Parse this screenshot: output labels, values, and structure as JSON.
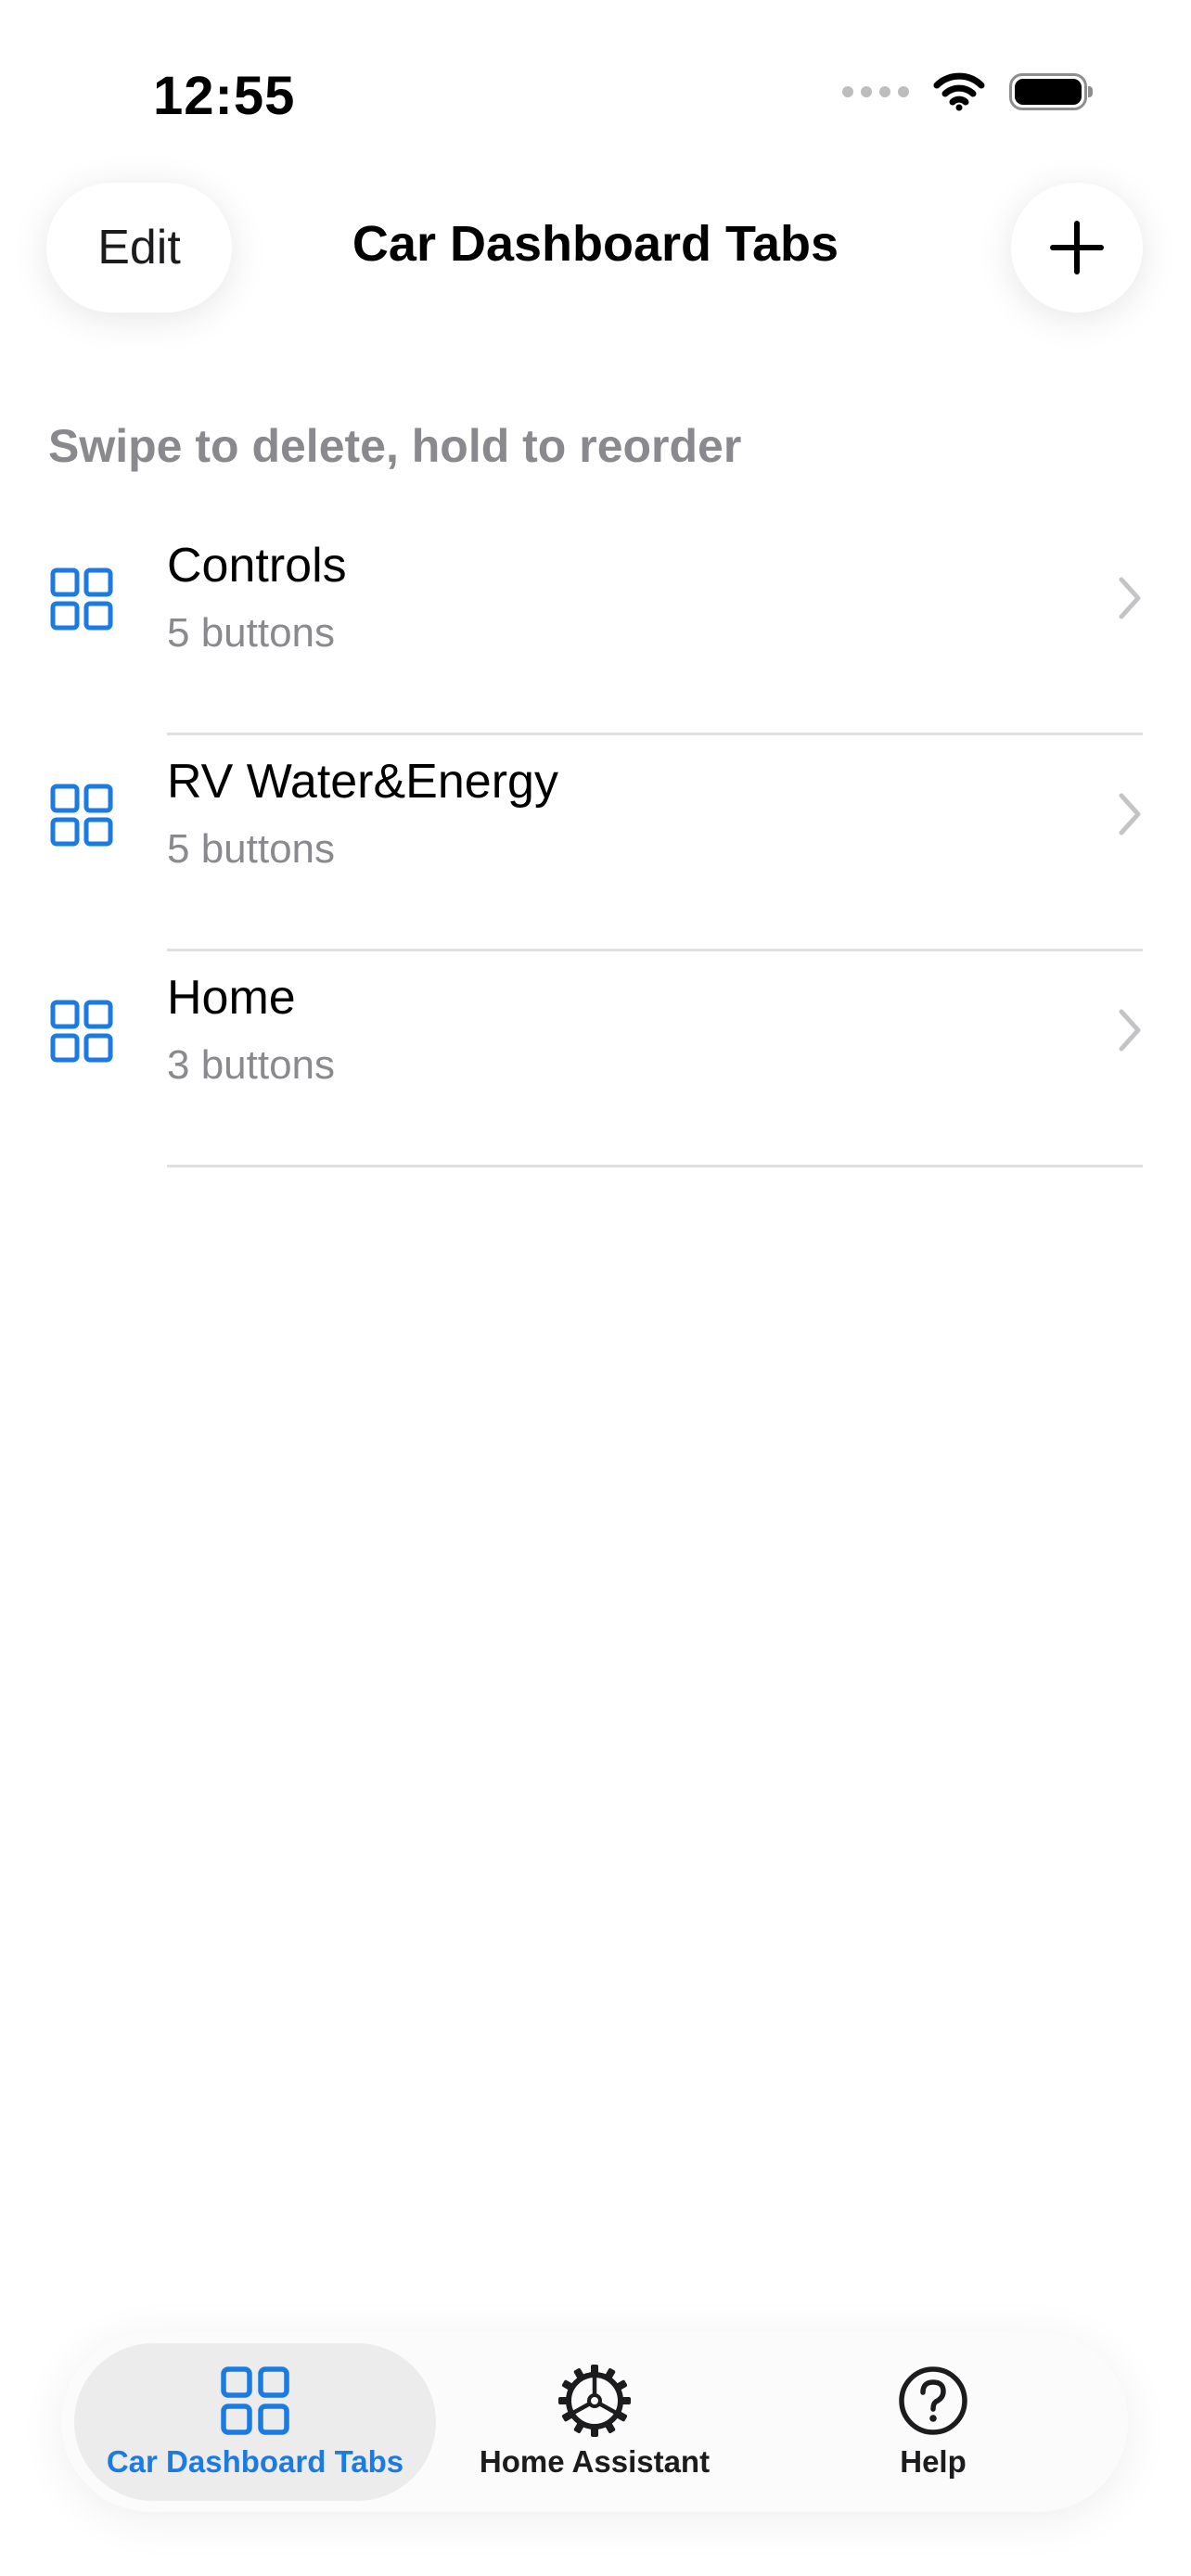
{
  "status_bar": {
    "time": "12:55"
  },
  "nav": {
    "edit_label": "Edit",
    "title": "Car Dashboard Tabs",
    "add_icon": "plus-icon"
  },
  "section": {
    "header": "Swipe to delete, hold to reorder"
  },
  "list": {
    "items": [
      {
        "title": "Controls",
        "subtitle": "5 buttons",
        "icon": "grid-icon"
      },
      {
        "title": "RV Water&Energy",
        "subtitle": "5 buttons",
        "icon": "grid-icon"
      },
      {
        "title": "Home",
        "subtitle": "3 buttons",
        "icon": "grid-icon"
      }
    ]
  },
  "tab_bar": {
    "tabs": [
      {
        "label": "Car Dashboard Tabs",
        "icon": "grid-icon",
        "active": true
      },
      {
        "label": "Home Assistant",
        "icon": "gear-icon",
        "active": false
      },
      {
        "label": "Help",
        "icon": "question-circle-icon",
        "active": false
      }
    ]
  },
  "colors": {
    "accent": "#1b7be0",
    "secondary_text": "#8a8a8e",
    "divider": "#e0e0e3"
  }
}
